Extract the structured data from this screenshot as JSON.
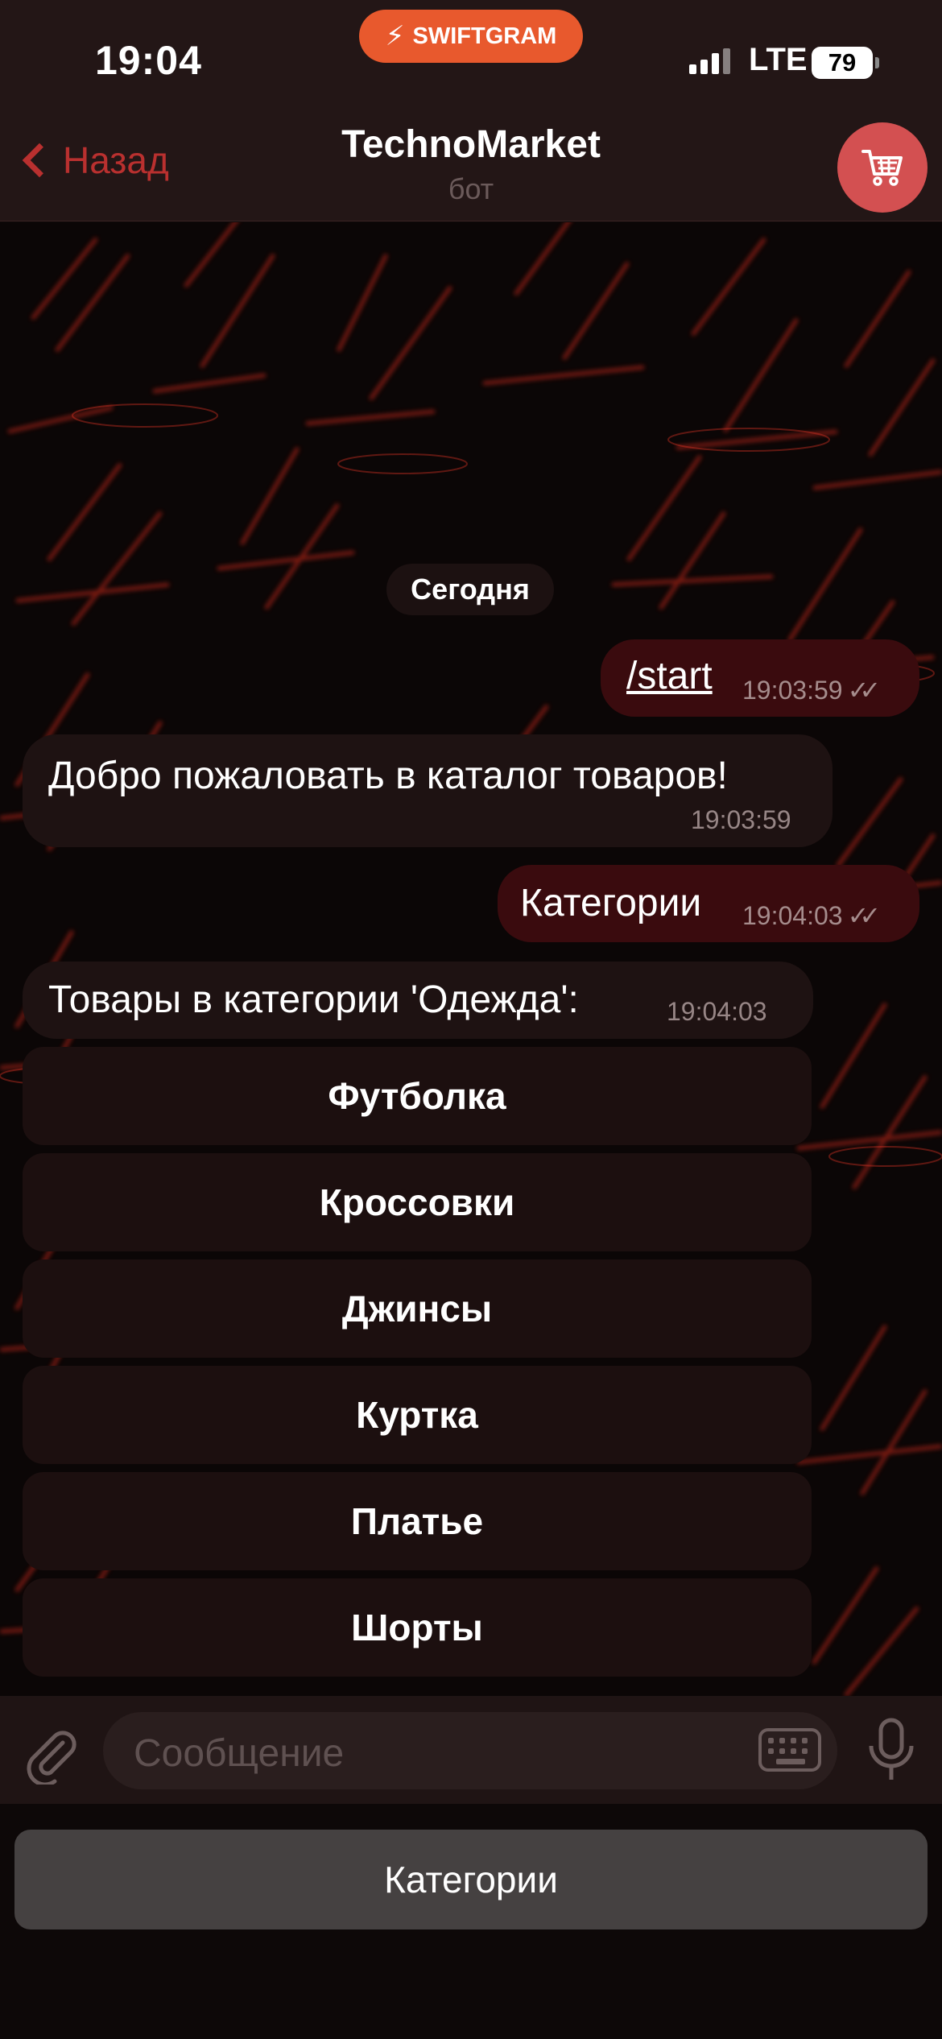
{
  "status_bar": {
    "time": "19:04",
    "badge": "SWIFTGRAM",
    "network": "LTE",
    "battery": "79"
  },
  "header": {
    "back_label": "Назад",
    "title": "TechnoMarket",
    "subtitle": "бот"
  },
  "chat": {
    "date_divider": "Сегодня",
    "messages": [
      {
        "text": "/start",
        "time": "19:03:59",
        "direction": "out"
      },
      {
        "text": "Добро пожаловать в каталог товаров!",
        "time": "19:03:59",
        "direction": "in"
      },
      {
        "text": "Категории",
        "time": "19:04:03",
        "direction": "out"
      },
      {
        "text": "Товары в категории 'Одежда':",
        "time": "19:04:03",
        "direction": "in"
      }
    ],
    "inline_buttons": [
      "Футболка",
      "Кроссовки",
      "Джинсы",
      "Куртка",
      "Платье",
      "Шорты"
    ]
  },
  "input": {
    "placeholder": "Сообщение"
  },
  "reply_keyboard": {
    "button": "Категории"
  },
  "colors": {
    "accent": "#b9302f",
    "cart": "#d35051",
    "outgoing_bubble": "#3a0b0e",
    "incoming_bubble": "#1e1212",
    "badge": "#e8592d"
  },
  "icons": [
    "lightning-icon",
    "signal-icon",
    "battery-icon",
    "chevron-left-icon",
    "cart-icon",
    "paperclip-icon",
    "keyboard-icon",
    "microphone-icon",
    "double-check-icon"
  ]
}
